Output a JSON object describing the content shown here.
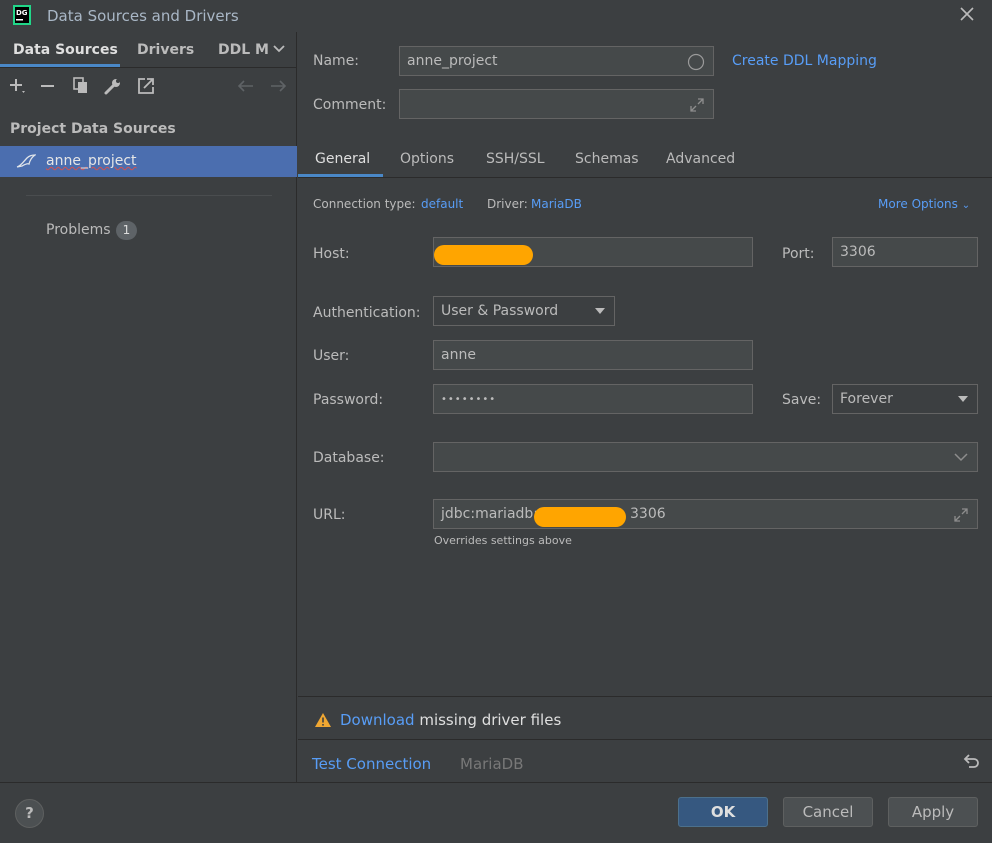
{
  "window": {
    "title": "Data Sources and Drivers",
    "app_icon_text": "DG"
  },
  "left": {
    "tabs": [
      {
        "label": "Data Sources",
        "active": true
      },
      {
        "label": "Drivers",
        "active": false
      },
      {
        "label": "DDL M",
        "active": false
      }
    ],
    "toolbar": [
      "add-icon",
      "remove-icon",
      "duplicate-icon",
      "wrench-icon",
      "jump-icon",
      "back-arrow-icon",
      "forward-arrow-icon"
    ],
    "section_header": "Project Data Sources",
    "items": [
      {
        "label": "anne_project",
        "selected": true,
        "icon": "mariadb-icon"
      }
    ],
    "problems": {
      "label": "Problems",
      "count": "1"
    }
  },
  "form": {
    "name_label": "Name:",
    "name_value": "anne_project",
    "create_ddl_link": "Create DDL Mapping",
    "comment_label": "Comment:",
    "comment_value": "",
    "tabs": [
      {
        "label": "General",
        "active": true
      },
      {
        "label": "Options",
        "active": false
      },
      {
        "label": "SSH/SSL",
        "active": false
      },
      {
        "label": "Schemas",
        "active": false
      },
      {
        "label": "Advanced",
        "active": false
      }
    ],
    "connection_type_label": "Connection type:",
    "connection_type_value": "default",
    "driver_label": "Driver:",
    "driver_value": "MariaDB",
    "more_options": "More Options",
    "host_label": "Host:",
    "host_value": "",
    "port_label": "Port:",
    "port_value": "3306",
    "auth_label": "Authentication:",
    "auth_value": "User & Password",
    "user_label": "User:",
    "user_value": "anne",
    "password_label": "Password:",
    "password_value": "••••••••",
    "save_label": "Save:",
    "save_value": "Forever",
    "database_label": "Database:",
    "database_value": "",
    "url_label": "URL:",
    "url_prefix": "jdbc:mariadb:",
    "url_suffix": "3306",
    "url_hint": "Overrides settings above"
  },
  "warning": {
    "link": "Download",
    "text": " missing driver files"
  },
  "test": {
    "link": "Test Connection",
    "driver": "MariaDB"
  },
  "footer": {
    "help": "?",
    "ok": "OK",
    "cancel": "Cancel",
    "apply": "Apply"
  },
  "colors": {
    "accent": "#589df6",
    "selection": "#4b6eaf",
    "warning": "#f0a732",
    "redaction": "#ffa500"
  }
}
